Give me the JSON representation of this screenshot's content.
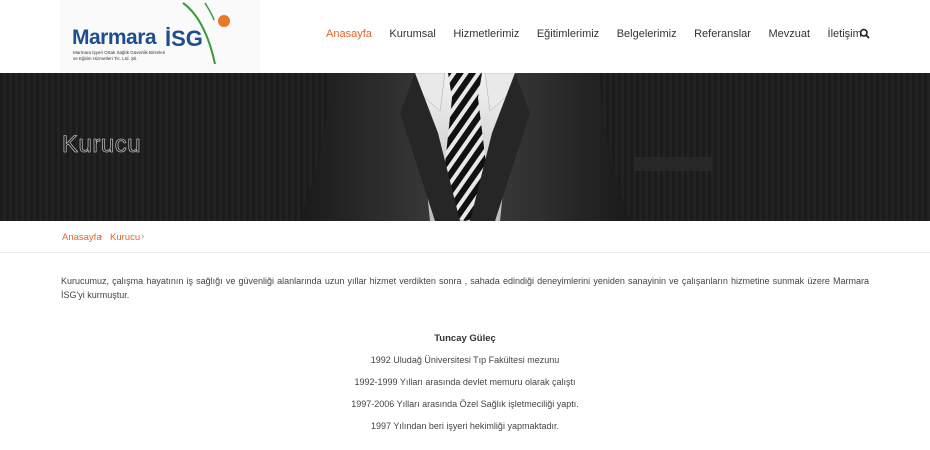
{
  "header": {
    "logo": {
      "word": "Marmara",
      "isg": "İSG",
      "sub1": "Marmara İşyeri Ortak Sağlık Güvenlik Birimleri",
      "sub2": "ve Eğitim Hizmetleri Tic. Ltd. Şti."
    },
    "nav": [
      "Anasayfa",
      "Kurumsal",
      "Hizmetlerimiz",
      "Eğitimlerimiz",
      "Belgelerimiz",
      "Referanslar",
      "Mevzuat",
      "İletişim"
    ],
    "active_nav": "Anasayfa"
  },
  "hero": {
    "title": "Kurucu"
  },
  "breadcrumb": [
    "Anasayfa",
    "Kurucu"
  ],
  "content": {
    "intro": "Kurucumuz, çalışma hayatının iş sağlığı ve güvenliği alanlarında uzun yıllar hizmet verdikten sonra , sahada edindiği deneyimlerini yeniden sanayinin ve çalışanların hizmetine sunmak üzere Marmara İSG'yi kurmuştur.",
    "name": "Tuncay Güleç",
    "lines": [
      "1992 Uludağ Üniversitesi Tıp Fakültesi mezunu",
      "1992-1999 Yılları arasında devlet memuru olarak çalıştı",
      "1997-2006 Yılları arasında Özel Sağlık işletmeciliği yaptı.",
      "1997 Yılından beri işyeri hekimliği yapmaktadır."
    ]
  },
  "colors": {
    "accent": "#e2652a",
    "brand_blue": "#1f4e8f",
    "logo_green": "#3a9a3a"
  }
}
